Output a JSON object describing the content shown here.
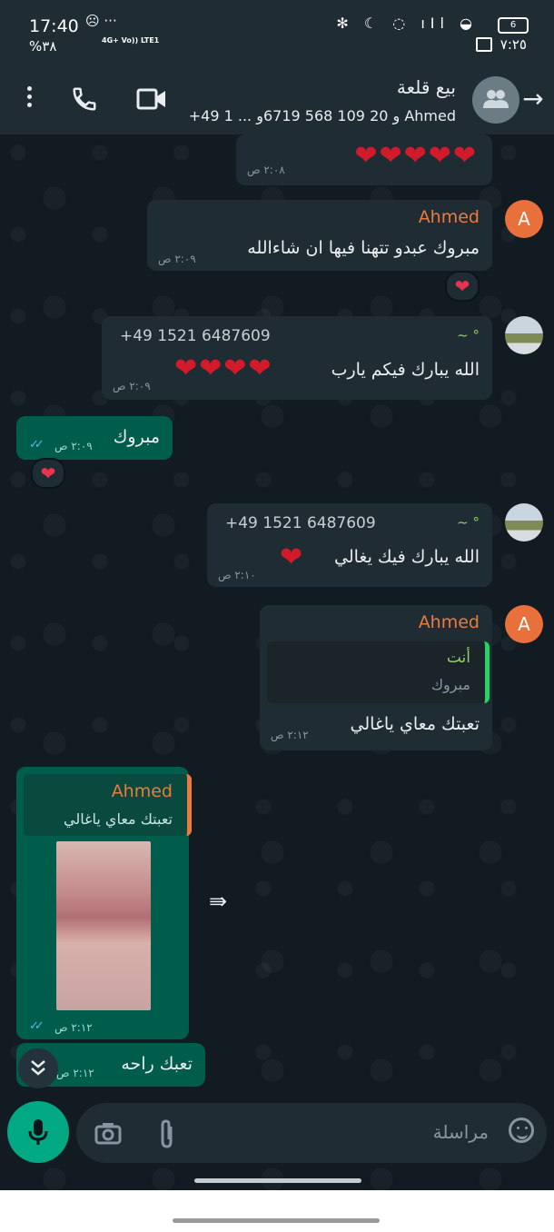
{
  "status_bar": {
    "time": "17:40",
    "battery_percent": "%٣٨",
    "network": "4G+ Vo)) LTE1",
    "battery_level": "6",
    "clock_right": "٧:٢٥"
  },
  "header": {
    "title": "بيع قلعة",
    "participants": "+49 1 ... و 20 109 568 6719و Ahmed"
  },
  "messages": [
    {
      "type": "in",
      "hearts": "❤❤❤❤❤",
      "time": "٢:٠٨ ص"
    },
    {
      "type": "in",
      "sender": "Ahmed",
      "avatar": "A",
      "text": "مبروك عبدو تتهنا فيها ان شاءالله",
      "time": "٢:٠٩ ص",
      "reaction": "❤"
    },
    {
      "type": "in",
      "phone": "+49 1521 6487609",
      "tilde": "~ °",
      "text": "الله يبارك فيكم يارب",
      "hearts": "❤❤❤❤",
      "time": "٢:٠٩ ص"
    },
    {
      "type": "out",
      "text": "مبروك",
      "time": "٢:٠٩ ص",
      "reaction": "❤"
    },
    {
      "type": "in",
      "phone": "+49 1521 6487609",
      "tilde": "~ °",
      "text": "الله يبارك فيك يغالي",
      "hearts": "❤",
      "time": "٢:١٠ ص"
    },
    {
      "type": "in",
      "sender": "Ahmed",
      "avatar": "A",
      "quote_author": "أنت",
      "quote_text": "مبروك",
      "text": "تعبتك معاي ياغالي",
      "time": "٢:١٢ ص"
    },
    {
      "type": "out",
      "quote_author": "Ahmed",
      "quote_text": "تعبتك معاي ياغالي",
      "time": "٢:١٢ ص"
    },
    {
      "type": "out",
      "text": "تعبك راحه",
      "time": "٢:١٢ ص"
    }
  ],
  "composer": {
    "placeholder": "مراسلة"
  },
  "colors": {
    "background": "#0b141a",
    "incoming": "#202c33",
    "outgoing": "#005c4b",
    "accent": "#00a884",
    "sender": "#ea7b3c"
  }
}
